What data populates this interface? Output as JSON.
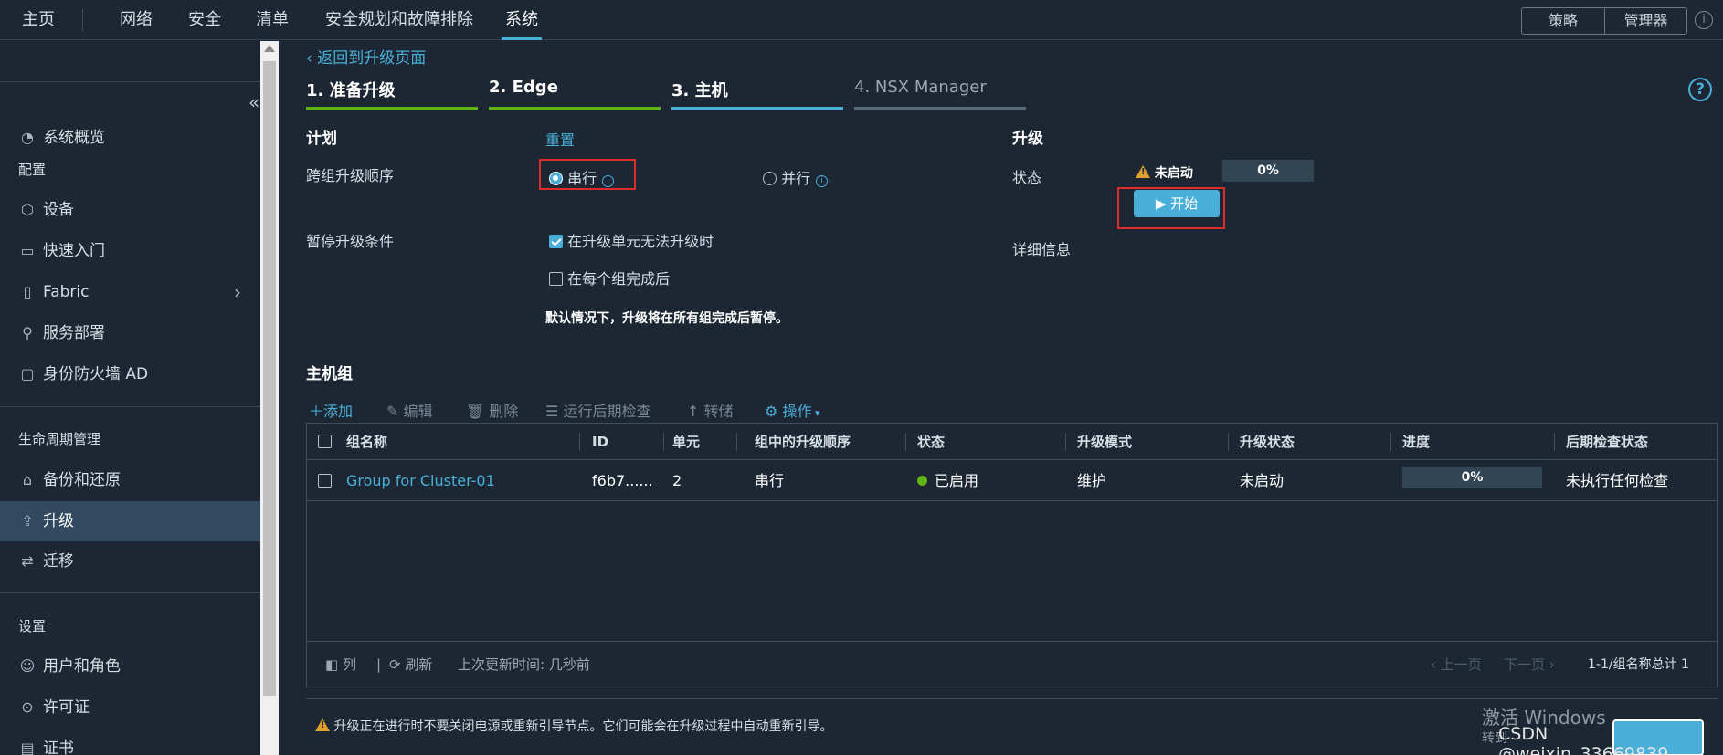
{
  "nav": {
    "tabs": [
      "主页",
      "网络",
      "安全",
      "清单",
      "安全规划和故障排除",
      "系统"
    ],
    "active": "系统",
    "mode_buttons": [
      "策略",
      "管理器"
    ],
    "info_icon": "info-icon"
  },
  "sidebar": {
    "overview": "系统概览",
    "config_head": "配置",
    "config_items": [
      "设备",
      "快速入门",
      "Fabric",
      "服务部署",
      "身份防火墙 AD"
    ],
    "lifecycle_head": "生命周期管理",
    "lifecycle_items": [
      "备份和还原",
      "升级",
      "迁移"
    ],
    "active": "升级",
    "settings_head": "设置",
    "settings_items": [
      "用户和角色",
      "许可证",
      "证书"
    ]
  },
  "main": {
    "back_link": "返回到升级页面",
    "steps": [
      {
        "label": "1. 准备升级",
        "color": "#60b515"
      },
      {
        "label": "2. Edge",
        "color": "#60b515"
      },
      {
        "label": "3. 主机",
        "color": "#49afd9"
      },
      {
        "label": "4. NSX Manager",
        "color": "#5b6b79"
      }
    ],
    "plan": {
      "title": "计划",
      "reset": "重置",
      "order_label": "跨组升级顺序",
      "serial": "串行",
      "parallel": "并行",
      "pause_label": "暂停升级条件",
      "pause_opt1": "在升级单元无法升级时",
      "pause_opt2": "在每个组完成后",
      "default_note": "默认情况下，升级将在所有组完成后暂停。"
    },
    "upgrade": {
      "title": "升级",
      "status_label": "状态",
      "status_value": "未启动",
      "progress": "0%",
      "start_button": "▶ 开始",
      "details_label": "详细信息"
    },
    "host_groups": {
      "title": "主机组",
      "toolbar": [
        "添加",
        "编辑",
        "删除",
        "运行后期检查",
        "转储",
        "操作"
      ],
      "columns": [
        "组名称",
        "ID",
        "单元",
        "组中的升级顺序",
        "状态",
        "升级模式",
        "升级状态",
        "进度",
        "后期检查状态"
      ],
      "rows": [
        {
          "name": "Group for Cluster-01",
          "id": "f6b7......",
          "units": "2",
          "order": "串行",
          "state": "已启用",
          "mode": "维护",
          "upgrade_state": "未启动",
          "progress": "0%",
          "post_check": "未执行任何检查"
        }
      ],
      "footer": {
        "columns": "列",
        "refresh": "刷新",
        "last_updated": "上次更新时间: 几秒前",
        "prev": "上一页",
        "next": "下一页",
        "total": "1-1/组名称总计 1"
      }
    },
    "warning": "升级正在进行时不要关闭电源或重新引导节点。它们可能会在升级过程中自动重新引导。"
  },
  "overlay": {
    "win_activate": "激活 Windows",
    "win_sub": "转到",
    "csdn": "CSDN @weixin_33669839"
  }
}
